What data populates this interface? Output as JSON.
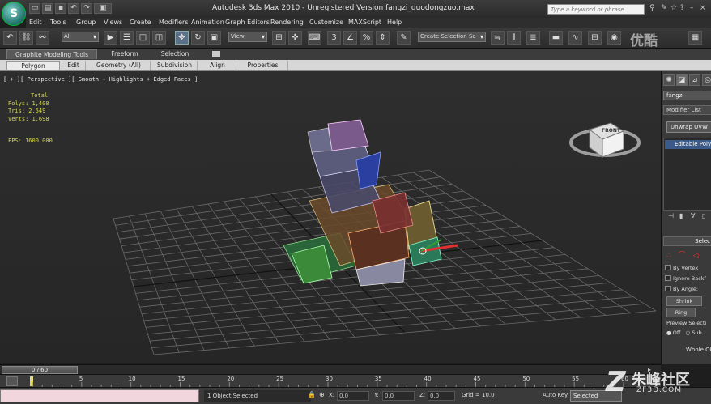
{
  "window": {
    "title": "Autodesk 3ds Max 2010 - Unregistered Version   fangzi_duodongzuo.max",
    "search_placeholder": "Type a keyword or phrase",
    "app_logo": "S"
  },
  "menu": [
    "Edit",
    "Tools",
    "Group",
    "Views",
    "Create",
    "Modifiers",
    "Animation",
    "Graph Editors",
    "Rendering",
    "Customize",
    "MAXScript",
    "Help"
  ],
  "toolbar": {
    "filter_dropdown": "All",
    "coord_dropdown": "View",
    "selection_set": "Create Selection Se"
  },
  "ribbon": {
    "tabs": [
      "Graphite Modeling Tools",
      "Freeform",
      "Selection"
    ],
    "panels": [
      "Polygon Modeling",
      "Edit",
      "Geometry (All)",
      "Subdivision",
      "Align",
      "Properties"
    ]
  },
  "viewport": {
    "label": "[ + ][ Perspective ][ Smooth + Highlights + Edged Faces ]",
    "stats": {
      "total_label": "Total",
      "polys": "Polys: 1,400",
      "tris": "Tris: 2,549",
      "verts": "Verts: 1,698",
      "fps": "FPS:  1600.000"
    },
    "viewcube_label": "FRONT"
  },
  "command_panel": {
    "object_name": "fangzi",
    "modifier_list": "Modifier List",
    "unwrap_button": "Unwrap UVW",
    "stack_item": "Editable Poly",
    "rollout_title": "Selec",
    "checks": [
      "By Vertex",
      "Ignore Backf",
      "By Angle:"
    ],
    "shrink": "Shrink",
    "ring": "Ring",
    "preview": "Preview Selecti",
    "off": "Off",
    "sub": "Sub",
    "whole": "Whole Ob"
  },
  "timeline": {
    "slider": "0 / 60",
    "ticks": [
      "0",
      "5",
      "10",
      "15",
      "20",
      "25",
      "30",
      "35",
      "40",
      "45",
      "50",
      "55",
      "60"
    ]
  },
  "status": {
    "message": "1 Object Selected",
    "x_label": "X:",
    "x_value": "0.0",
    "y_label": "Y:",
    "y_value": "0.0",
    "z_label": "Z:",
    "z_value": "0.0",
    "grid": "Grid = 10.0",
    "autokey": "Auto Key",
    "selected": "Selected"
  },
  "watermarks": {
    "youku": "优酷",
    "site_cn": "朱峰社区",
    "site_en": "ZF3D.COM"
  }
}
